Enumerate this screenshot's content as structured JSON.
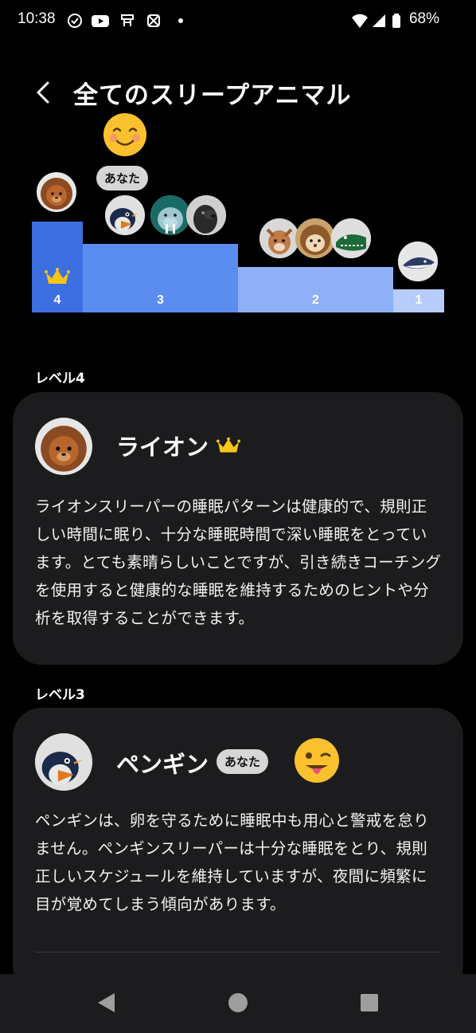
{
  "status_bar": {
    "time": "10:38",
    "battery": "68%"
  },
  "header": {
    "title": "全てのスリープアニマル"
  },
  "chart_data": {
    "type": "bar",
    "categories": [
      "4",
      "3",
      "2",
      "1"
    ],
    "values": [
      4,
      3,
      2,
      1
    ],
    "xlabel": "",
    "ylabel": "",
    "bar_colors": [
      "#3d6fe0",
      "#5b8cf0",
      "#8fb0f7",
      "#b7ccfa"
    ],
    "animals": [
      [
        "lion-icon"
      ],
      [
        "penguin-icon",
        "walrus-icon",
        "seal-icon"
      ],
      [
        "deer-icon",
        "hedgehog-icon",
        "crocodile-icon"
      ],
      [
        "shark-icon"
      ]
    ]
  },
  "you_label": "あなた",
  "levels": [
    {
      "label": "レベル4",
      "name": "ライオン",
      "description": "ライオンスリーパーの睡眠パターンは健康的で、規則正しい時間に眠り、十分な睡眠時間で深い睡眠をとっています。とても素晴らしいことですが、引き続きコーチングを使用すると健康的な睡眠を維持するためのヒントや分析を取得することができます。"
    },
    {
      "label": "レベル3",
      "name": "ペンギン",
      "badge": "あなた",
      "description": "ペンギンは、卵を守るために睡眠中も用心と警戒を怠りません。ペンギンスリーパーは十分な睡眠をとり、規則正しいスケジュールを維持していますが、夜間に頻繁に目が覚めてしまう傾向があります。"
    }
  ],
  "colors": {
    "accent": "#3d6fe0",
    "card_bg": "#1c1c1e",
    "crown": "#f5c518"
  }
}
